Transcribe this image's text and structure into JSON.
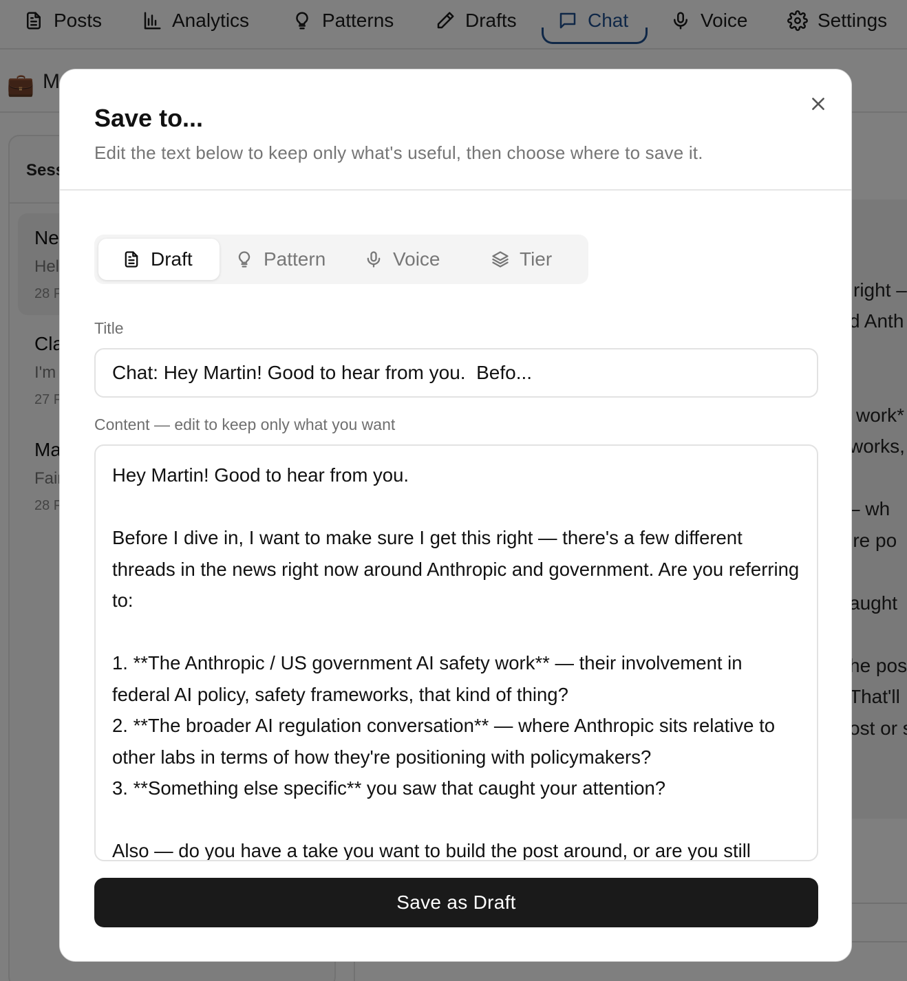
{
  "nav": {
    "items": [
      {
        "label": "Posts",
        "icon": "document-icon"
      },
      {
        "label": "Analytics",
        "icon": "bar-chart-icon"
      },
      {
        "label": "Patterns",
        "icon": "lightbulb-icon"
      },
      {
        "label": "Drafts",
        "icon": "pencil-icon"
      },
      {
        "label": "Chat",
        "icon": "chat-bubble-icon",
        "active": true
      },
      {
        "label": "Voice",
        "icon": "microphone-icon"
      },
      {
        "label": "Settings",
        "icon": "gear-icon"
      }
    ],
    "active_color": "#1f4f8f"
  },
  "subbar": {
    "text": "M"
  },
  "sessions": {
    "heading": "Sess",
    "items": [
      {
        "title": "Ne",
        "preview": "Hel",
        "date": "28 F"
      },
      {
        "title": "Cla",
        "preview": "I'm",
        "date": "27 F"
      },
      {
        "title": "Ma",
        "preview": "Fair",
        "date": "28 F"
      }
    ]
  },
  "chat_fragments": [
    "right –",
    "d Anth",
    "work*",
    "works,",
    "– wh",
    "'re po",
    "aught",
    "he pos",
    "That'll",
    "ost or s"
  ],
  "modal": {
    "title": "Save to...",
    "subtitle": "Edit the text below to keep only what's useful, then choose where to save it.",
    "tabs": [
      {
        "label": "Draft",
        "icon": "document-icon",
        "active": true
      },
      {
        "label": "Pattern",
        "icon": "lightbulb-icon"
      },
      {
        "label": "Voice",
        "icon": "microphone-icon"
      },
      {
        "label": "Tier",
        "icon": "layers-icon"
      }
    ],
    "title_label": "Title",
    "title_value": "Chat: Hey Martin! Good to hear from you.  Befo...",
    "content_label": "Content — edit to keep only what you want",
    "content_value": "Hey Martin! Good to hear from you.\n\nBefore I dive in, I want to make sure I get this right — there's a few different threads in the news right now around Anthropic and government. Are you referring to:\n\n1. **The Anthropic / US government AI safety work** — their involvement in federal AI policy, safety frameworks, that kind of thing?\n2. **The broader AI regulation conversation** — where Anthropic sits relative to other labs in terms of how they're positioning with policymakers?\n3. **Something else specific** you saw that caught your attention?\n\nAlso — do you have a take you want to build the post around, or are you still",
    "save_label": "Save as Draft"
  }
}
